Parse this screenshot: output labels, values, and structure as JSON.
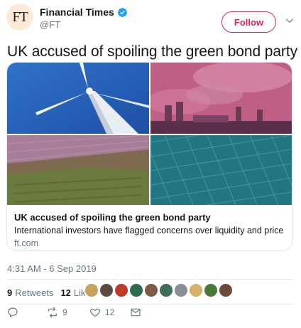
{
  "account": {
    "avatar_text": "FT",
    "name": "Financial Times",
    "handle": "@FT",
    "follow_label": "Follow"
  },
  "tweet": {
    "text": "UK accused of spoiling the green bond party",
    "timestamp": "4:31 AM - 6 Sep 2019"
  },
  "card": {
    "title": "UK accused of spoiling the green bond party",
    "description": "International investors have flagged concerns over liquidity and price",
    "domain": "ft.com"
  },
  "stats": {
    "retweets_count": "9",
    "retweets_label": "Retweets",
    "likes_count": "12",
    "likes_label": "Likes"
  },
  "liker_colors": [
    "#c8a25a",
    "#5b4a3d",
    "#c0392b",
    "#2e6b4f",
    "#7a5c48",
    "#3d6e57",
    "#8a8f94",
    "#d6b26a",
    "#4a7a3a",
    "#6b4a3a"
  ],
  "actions": {
    "retweet_count": "9",
    "like_count": "12"
  },
  "colors": {
    "accent": "#e0245e",
    "verified": "#1da1f2",
    "muted": "#657786",
    "avatar_bg": "#fde9d5"
  }
}
